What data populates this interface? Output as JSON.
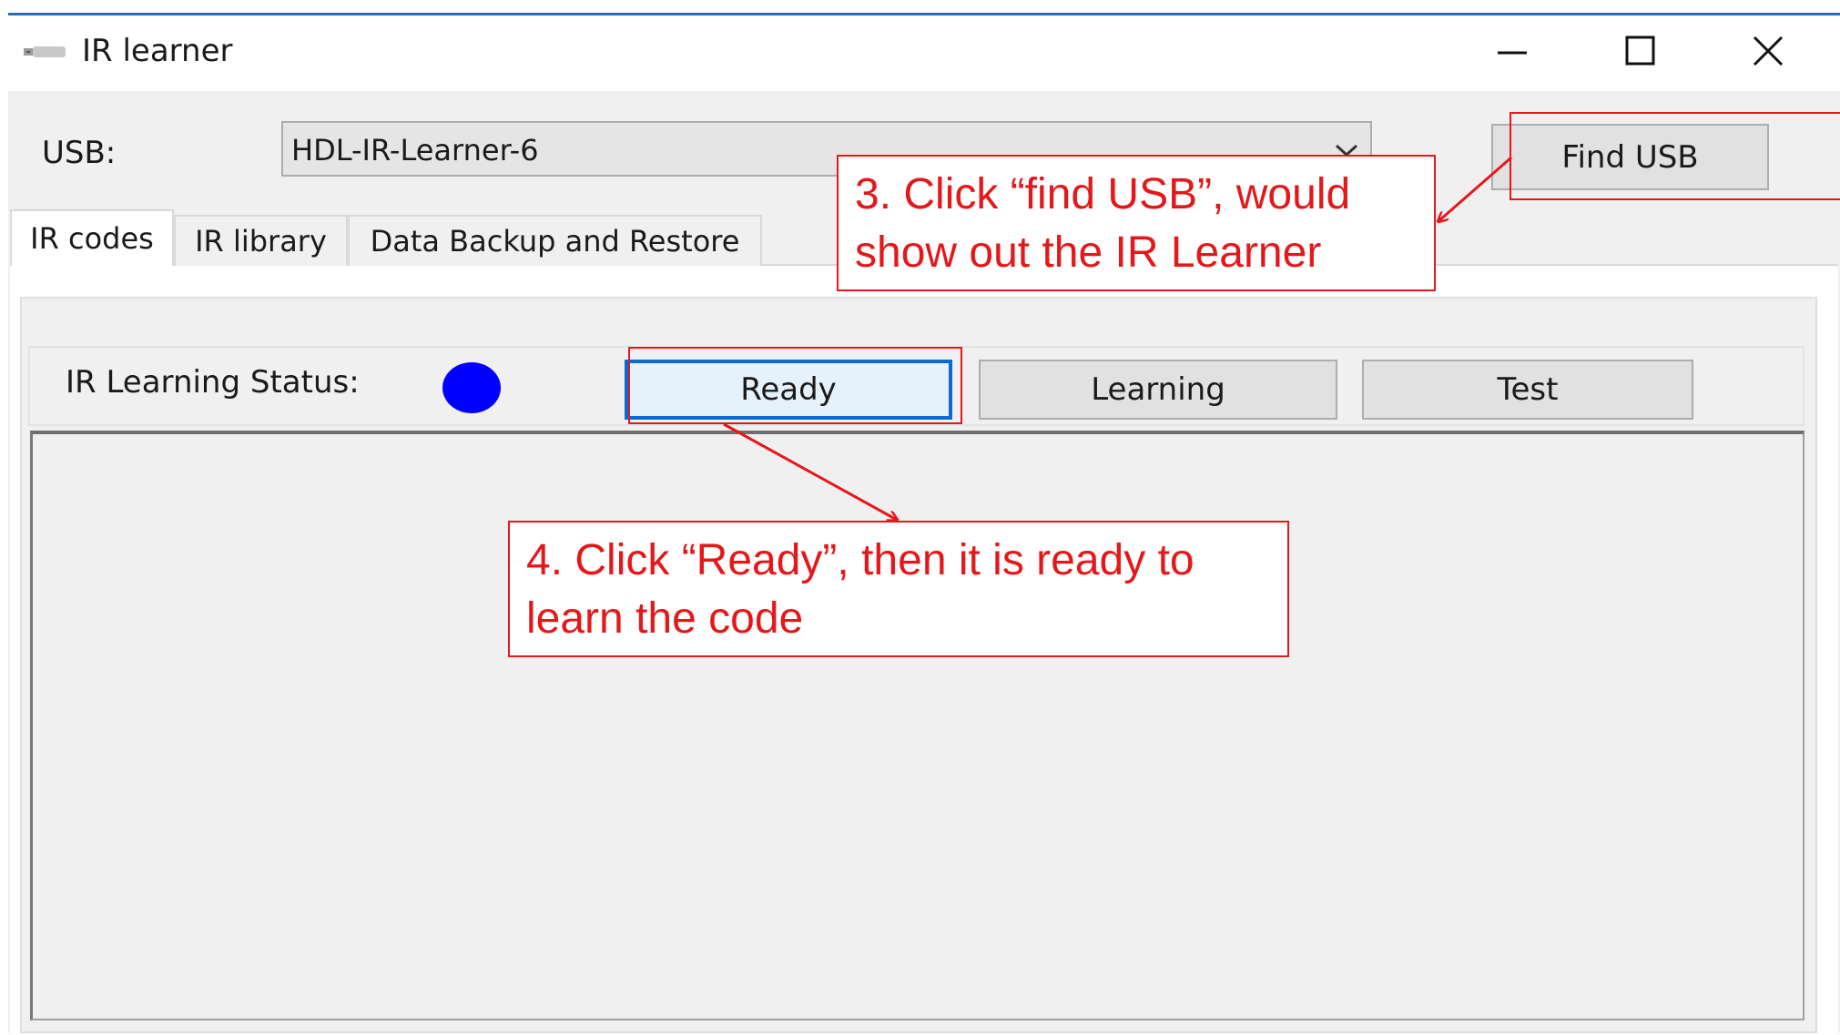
{
  "window": {
    "title": "IR learner",
    "controls": {
      "minimize": "minimize-icon",
      "maximize": "maximize-icon",
      "close": "close-icon"
    }
  },
  "usb": {
    "label": "USB:",
    "selected": "HDL-IR-Learner-6",
    "find_button": "Find USB"
  },
  "tabs": [
    {
      "label": "IR codes",
      "active": true
    },
    {
      "label": "IR library",
      "active": false
    },
    {
      "label": "Data Backup and Restore",
      "active": false
    }
  ],
  "status": {
    "label": "IR Learning Status:",
    "indicator_color": "#0000ff",
    "buttons": {
      "ready": "Ready",
      "learning": "Learning",
      "test": "Test"
    }
  },
  "annotations": {
    "step3": {
      "line1": "3. Click “find USB”, would",
      "line2": "show out the IR Learner"
    },
    "step4": {
      "line1": "4. Click “Ready”,    then it is ready to",
      "line2": "learn the code"
    },
    "color": "#e4181b"
  }
}
